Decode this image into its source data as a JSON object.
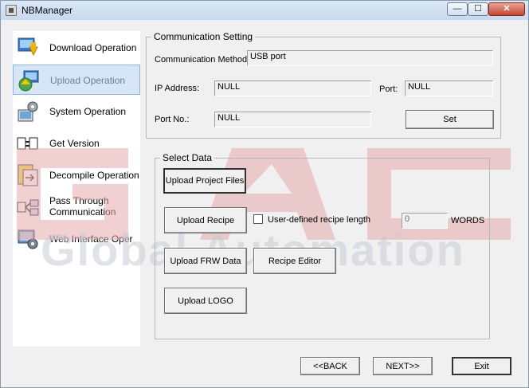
{
  "window": {
    "title": "NBManager"
  },
  "titlebar_buttons": {
    "minimize": "—",
    "maximize": "☐",
    "close": "✕"
  },
  "sidebar": {
    "items": [
      {
        "label": "Download Operation",
        "icon": "download-icon",
        "selected": false
      },
      {
        "label": "Upload Operation",
        "icon": "upload-icon",
        "selected": true
      },
      {
        "label": "System Operation",
        "icon": "system-icon",
        "selected": false
      },
      {
        "label": "Get Version",
        "icon": "version-icon",
        "selected": false
      },
      {
        "label": "Decompile Operation",
        "icon": "decompile-icon",
        "selected": false
      },
      {
        "label": "Pass Through Communication",
        "icon": "pass-through-icon",
        "selected": false
      },
      {
        "label": "Web Interface Oper",
        "icon": "web-interface-icon",
        "selected": false
      }
    ]
  },
  "communication": {
    "title": "Communication Setting",
    "method_label": "Communication Method:",
    "method_value": "USB port",
    "ip_label": "IP Address:",
    "ip_value": "NULL",
    "port_label": "Port:",
    "port_value": "NULL",
    "portno_label": "Port No.:",
    "portno_value": "NULL",
    "set_button": "Set"
  },
  "select_data": {
    "title": "Select Data",
    "upload_project": "Upload Project Files",
    "upload_recipe": "Upload Recipe",
    "recipe_length_label": "User-defined recipe length",
    "recipe_length_value": "0",
    "words_label": "WORDS",
    "upload_frw": "Upload FRW Data",
    "recipe_editor": "Recipe Editor",
    "upload_logo": "Upload LOGO"
  },
  "footer": {
    "back": "<<BACK",
    "next": "NEXT>>",
    "exit": "Exit"
  },
  "watermark": {
    "line1": "GAC",
    "line2": "Global Automation",
    "color_red": "#e3a9a9",
    "color_grey": "#c8ccd6"
  }
}
